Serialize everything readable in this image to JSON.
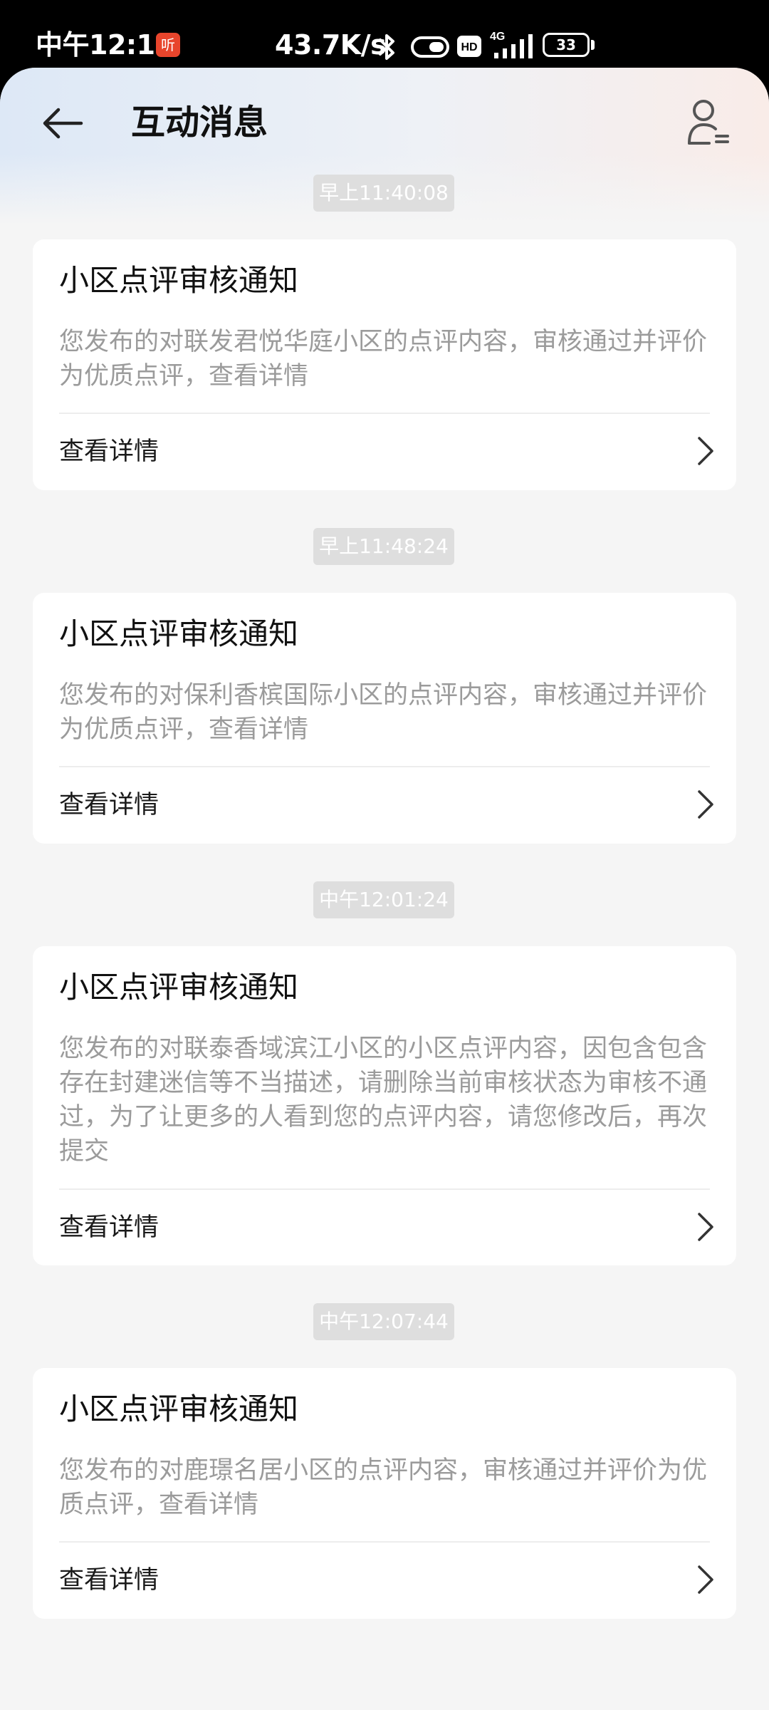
{
  "status_bar": {
    "time": "中午12:12",
    "app_icon_text": "听",
    "network_speed": "43.7K/s",
    "network_type": "4G",
    "hd_badge": "HD",
    "battery_level": "33",
    "icons": [
      "bluetooth-icon",
      "vibrate-icon",
      "hd-icon",
      "signal-icon",
      "battery-icon"
    ]
  },
  "header": {
    "title": "互动消息",
    "back_icon": "arrow-left-icon",
    "profile_icon": "user-list-icon"
  },
  "messages": [
    {
      "time": "早上11:40:08",
      "title": "小区点评审核通知",
      "body": "您发布的对联发君悦华庭小区的点评内容，审核通过并评价为优质点评，查看详情",
      "action": "查看详情"
    },
    {
      "time": "早上11:48:24",
      "title": "小区点评审核通知",
      "body": "您发布的对保利香槟国际小区的点评内容，审核通过并评价为优质点评，查看详情",
      "action": "查看详情"
    },
    {
      "time": "中午12:01:24",
      "title": "小区点评审核通知",
      "body": "您发布的对联泰香域滨江小区的小区点评内容，因包含包含存在封建迷信等不当描述，请删除当前审核状态为审核不通过，为了让更多的人看到您的点评内容，请您修改后，再次提交",
      "action": "查看详情"
    },
    {
      "time": "中午12:07:44",
      "title": "小区点评审核通知",
      "body": "您发布的对鹿璟名居小区的点评内容，审核通过并评价为优质点评，查看详情",
      "action": "查看详情"
    }
  ],
  "colors": {
    "page_background": "#f5f5f5",
    "card_background": "#ffffff",
    "timestamp_badge": "#dedede",
    "body_text": "#9b9b9b",
    "title_text": "#111111"
  }
}
